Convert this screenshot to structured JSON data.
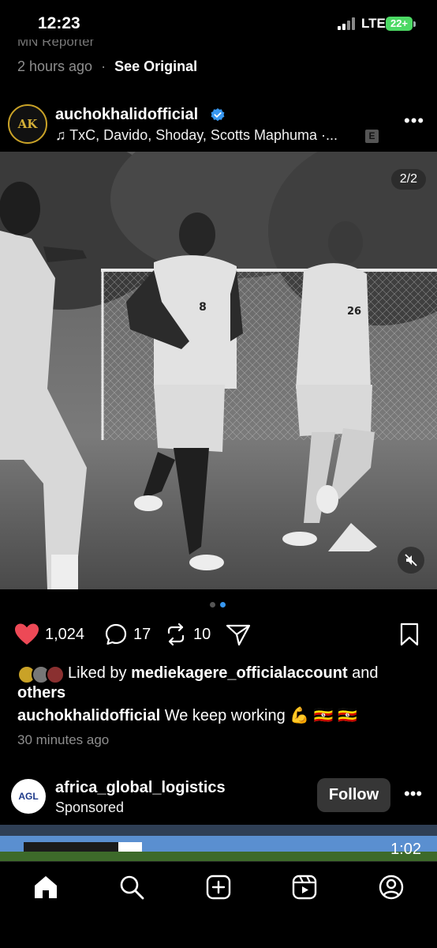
{
  "status_bar": {
    "time": "12:23",
    "network": "LTE",
    "battery": "22+"
  },
  "previous_post": {
    "snippet": "MN Reporter",
    "time": "2 hours ago",
    "separator": "·",
    "see_original": "See Original"
  },
  "post": {
    "username": "auchokhalidofficial",
    "avatar_initials": "AK",
    "music": "♫ TxC, Davido, Shoday, Scotts Maphuma ·...",
    "explicit_label": "E",
    "more_icon": "•••",
    "image_counter": "2/2",
    "likes": "1,024",
    "comments": "17",
    "reposts": "10",
    "liked_by_prefix": "Liked by ",
    "liked_by_user": "mediekagere_officialaccount",
    "liked_by_and": " and ",
    "liked_by_others": "others",
    "caption_user": "auchokhalidofficial",
    "caption_text": " We keep working 💪 🇺🇬 🇺🇬",
    "time_ago": "30 minutes ago",
    "carousel_count": 2,
    "carousel_active": 2,
    "jersey_numbers": [
      "8",
      "26"
    ]
  },
  "ad": {
    "username": "africa_global_logistics",
    "avatar_text": "AGL",
    "sponsored": "Sponsored",
    "follow_label": "Follow",
    "more_icon": "•••",
    "duration": "1:02"
  },
  "tabs": [
    {
      "name": "home-icon"
    },
    {
      "name": "search-icon"
    },
    {
      "name": "create-icon"
    },
    {
      "name": "reels-icon"
    },
    {
      "name": "profile-icon"
    }
  ],
  "colors": {
    "like": "#ed4956",
    "verified": "#3797f0",
    "follow_bg": "#363636",
    "battery": "#4cd964"
  }
}
